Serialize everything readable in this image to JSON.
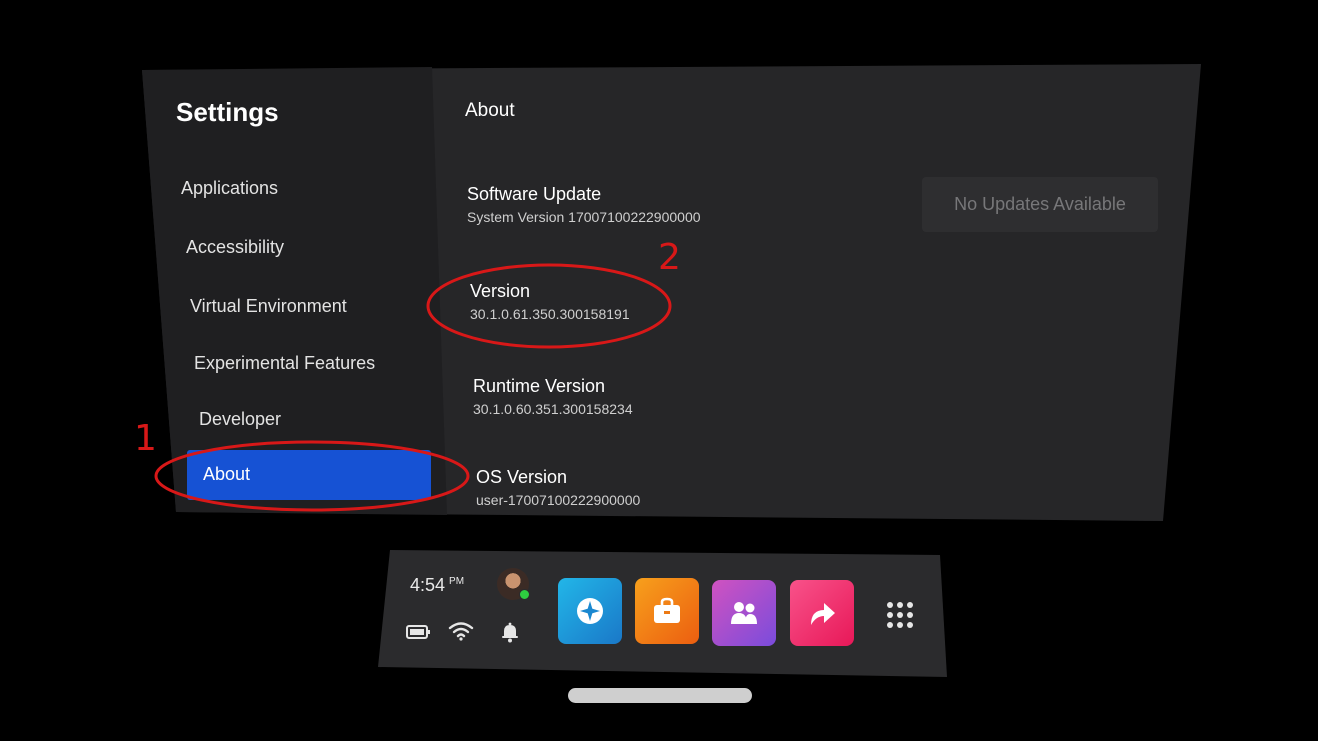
{
  "settings": {
    "title": "Settings",
    "nav": [
      {
        "label": "Applications"
      },
      {
        "label": "Accessibility"
      },
      {
        "label": "Virtual Environment"
      },
      {
        "label": "Experimental Features"
      },
      {
        "label": "Developer"
      },
      {
        "label": "About"
      }
    ],
    "active_nav": "About"
  },
  "about": {
    "section_title": "About",
    "software_update": {
      "heading": "Software Update",
      "sub": "System Version 17007100222900000",
      "button_label": "No Updates Available"
    },
    "version": {
      "heading": "Version",
      "sub": "30.1.0.61.350.300158191"
    },
    "runtime_version": {
      "heading": "Runtime Version",
      "sub": "30.1.0.60.351.300158234"
    },
    "os_version": {
      "heading": "OS Version",
      "sub": "user-17007100222900000"
    }
  },
  "annotations": {
    "marker_1": "1",
    "marker_2": "2",
    "color": "#d81818"
  },
  "dock": {
    "time": "4:54",
    "ampm": "PM",
    "apps": [
      {
        "icon": "explore-icon",
        "color": "#1aa0d8"
      },
      {
        "icon": "store-icon",
        "color": "#f07a14"
      },
      {
        "icon": "people-icon",
        "color": "#a052d8"
      },
      {
        "icon": "share-icon",
        "color": "#f23a7a"
      }
    ],
    "system_icons": [
      "battery-icon",
      "wifi-icon",
      "bell-icon",
      "app-grid-icon"
    ]
  },
  "colors": {
    "accent": "#1652d4",
    "panel": "#262628",
    "sidebar": "#1f1f21"
  }
}
